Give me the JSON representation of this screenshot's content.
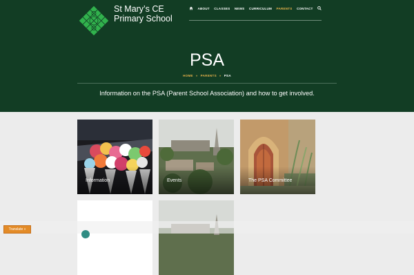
{
  "brand": {
    "name_line1": "St Mary’s CE",
    "name_line2": "Primary School"
  },
  "nav": {
    "items": [
      {
        "label": "ABOUT",
        "active": false
      },
      {
        "label": "CLASSES",
        "active": false
      },
      {
        "label": "NEWS",
        "active": false
      },
      {
        "label": "CURRICULUM",
        "active": false
      },
      {
        "label": "PARENTS",
        "active": true
      },
      {
        "label": "CONTACT",
        "active": false
      }
    ]
  },
  "page": {
    "title": "PSA",
    "breadcrumb": {
      "home": "HOME",
      "parent": "PARENTS",
      "current": "PSA",
      "separator": "»"
    },
    "intro": "Information on the PSA (Parent School Association) and how to get involved."
  },
  "cards": [
    {
      "label": "Information"
    },
    {
      "label": "Events"
    },
    {
      "label": "The PSA Committee"
    }
  ],
  "translate": {
    "label": "Translate »"
  },
  "colors": {
    "hero_bg": "#123d24",
    "accent": "#e7b24b",
    "page_bg": "#ececec",
    "translate_bg": "#e38b27"
  }
}
